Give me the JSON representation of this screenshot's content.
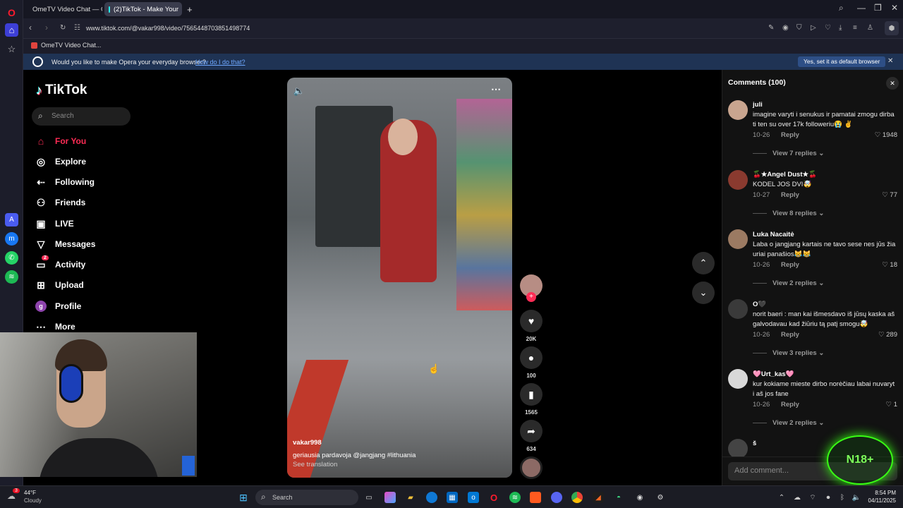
{
  "browser": {
    "tabs": [
      {
        "label": "OmeTV Video Chat — Or",
        "active": false
      },
      {
        "label": "(2)TikTok - Make Your",
        "active": true
      }
    ],
    "url": "www.tiktok.com/@vakar998/video/7565448703851498774",
    "bookmark": "OmeTV Video Chat...",
    "notice": {
      "text": "Would you like to make Opera your everyday browser?",
      "link": "How do I do that?",
      "button": "Yes, set it as default browser"
    }
  },
  "tiktok": {
    "logo": "TikTok",
    "search_placeholder": "Search",
    "nav": [
      {
        "label": "For You",
        "icon": "home-icon",
        "active": true
      },
      {
        "label": "Explore",
        "icon": "compass-icon"
      },
      {
        "label": "Following",
        "icon": "following-icon"
      },
      {
        "label": "Friends",
        "icon": "friends-icon"
      },
      {
        "label": "LIVE",
        "icon": "live-icon"
      },
      {
        "label": "Messages",
        "icon": "messages-icon"
      },
      {
        "label": "Activity",
        "icon": "activity-icon",
        "badge": "2"
      },
      {
        "label": "Upload",
        "icon": "upload-icon"
      },
      {
        "label": "Profile",
        "icon": "profile-icon",
        "avatar_letter": "g"
      },
      {
        "label": "More",
        "icon": "more-icon"
      }
    ]
  },
  "video": {
    "author": "vakar998",
    "caption": "geriausia pardavoja @jangjang  #lithuania",
    "see_translation": "See translation",
    "likes": "20K",
    "comments": "100",
    "saves": "1565",
    "shares": "634"
  },
  "comments_panel": {
    "title": "Comments (100)",
    "add_placeholder": "Add comment...",
    "items": [
      {
        "name": "juli",
        "text": "imagine varyti i senukus ir pamatai zmogu dirba ti ten su over 17k followeriu😭 ✌️",
        "date": "10-26",
        "reply": "Reply",
        "likes": "1948",
        "view": "View 7 replies",
        "avatar_color": "#c9a58f"
      },
      {
        "name": "🍒★Angel Dust★🍒",
        "text": "KODEL JOS DVI🤯",
        "date": "10-27",
        "reply": "Reply",
        "likes": "77",
        "view": "View 8 replies",
        "avatar_color": "#8a3a2f"
      },
      {
        "name": "Luka Nacaitė",
        "text": "Laba o jangjang kartais ne tavo sese nes jūs žia uriai panašios😹😹",
        "date": "10-26",
        "reply": "Reply",
        "likes": "18",
        "view": "View 2 replies",
        "avatar_color": "#9b7a62"
      },
      {
        "name": "O🖤",
        "text": "norit baeri : man kai išmesdavo iš jūsų kaska aš galvodavau kad žiūriu tą patį smogu🤯",
        "date": "10-26",
        "reply": "Reply",
        "likes": "289",
        "view": "View 3 replies",
        "avatar_color": "#3a3a3a"
      },
      {
        "name": "🩷Urt_kas🩷",
        "text": "kur kokiame mieste dirbo norėčiau labai nuvaryt i aš jos fane",
        "date": "10-26",
        "reply": "Reply",
        "likes": "1",
        "view": "View 2 replies",
        "avatar_color": "#d8d8d8"
      },
      {
        "name": "š",
        "text": "",
        "date": "",
        "reply": "",
        "likes": "",
        "view": "",
        "avatar_color": "#444"
      }
    ]
  },
  "overlay_badge": "N18+",
  "taskbar": {
    "weather_temp": "44°F",
    "weather_desc": "Cloudy",
    "weather_badge": "3",
    "search": "Search",
    "time": "8:54 PM",
    "date": "04/11/2025"
  }
}
